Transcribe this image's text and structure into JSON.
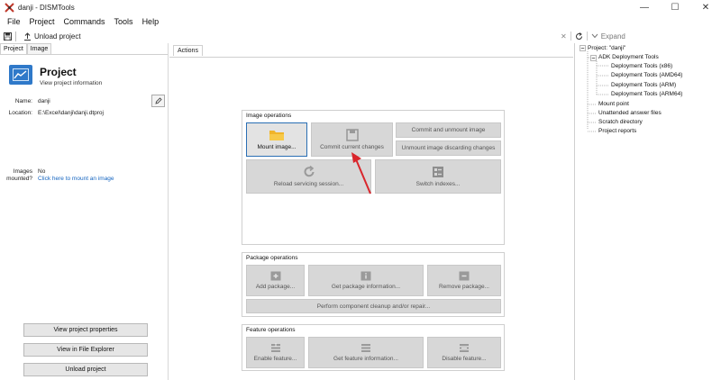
{
  "window": {
    "title": "danji - DISMTools",
    "minimize": "—",
    "maximize": "☐",
    "close": "✕"
  },
  "menu": [
    "File",
    "Project",
    "Commands",
    "Tools",
    "Help"
  ],
  "toolbar": {
    "unload_label": "Unload project",
    "expand_label": "Expand"
  },
  "left": {
    "tabs": [
      "Project",
      "Image"
    ],
    "project_title": "Project",
    "project_subtitle": "View project information",
    "name_label": "Name:",
    "name_value": "danji",
    "location_label": "Location:",
    "location_value": "E:\\Excel\\danji\\danji.dtproj",
    "images_label_1": "Images",
    "images_label_2": "mounted?",
    "images_value": "No",
    "mount_link": "Click here to mount an image",
    "buttons": [
      "View project properties",
      "View in File Explorer",
      "Unload project"
    ]
  },
  "actions": {
    "tab": "Actions",
    "image_ops": {
      "title": "Image operations",
      "mount": "Mount image...",
      "commit": "Commit current changes",
      "commit_unmount": "Commit and unmount image",
      "unmount_discard": "Unmount image discarding changes",
      "reload": "Reload servicing session...",
      "switch": "Switch indexes..."
    },
    "package_ops": {
      "title": "Package operations",
      "add": "Add package...",
      "info": "Get package information...",
      "remove": "Remove package...",
      "cleanup": "Perform component cleanup and/or repair..."
    },
    "feature_ops": {
      "title": "Feature operations",
      "enable": "Enable feature...",
      "info": "Get feature information...",
      "disable": "Disable feature..."
    }
  },
  "tree": {
    "root": "Project: \"danji\"",
    "adk": "ADK Deployment Tools",
    "adk_children": [
      "Deployment Tools (x86)",
      "Deployment Tools (AMD64)",
      "Deployment Tools (ARM)",
      "Deployment Tools (ARM64)"
    ],
    "others": [
      "Mount point",
      "Unattended answer files",
      "Scratch directory",
      "Project reports"
    ]
  },
  "colors": {
    "accent": "#2f79c9",
    "link": "#1565c0",
    "arrow": "#d9262c",
    "folder": "#f0b429"
  }
}
